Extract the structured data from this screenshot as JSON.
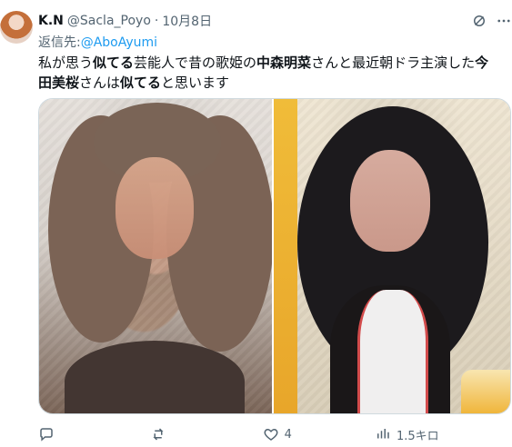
{
  "tweet": {
    "name": "K.N",
    "handle": "@Sacla_Poyo",
    "separator": "·",
    "date": "10月8日",
    "reply_to_prefix": "返信先:",
    "reply_to_handle": "@AboAyumi",
    "text": {
      "segment_1": "私が思う",
      "segment_2": "似てる",
      "segment_3": "芸能人で昔の歌姫の",
      "segment_4": "中森明菜",
      "segment_5": "さんと最近朝ドラ主演した",
      "segment_6": "今田美桜",
      "segment_7": "さんは",
      "segment_8": "似てる",
      "segment_9": "と思います"
    },
    "actions": {
      "likes": "4",
      "views": "1.5キロ"
    }
  },
  "icons": {
    "grok": "grok-icon",
    "more": "more-icon",
    "reply": "reply-icon",
    "retweet": "retweet-icon",
    "like": "heart-icon",
    "views": "views-icon",
    "bookmark": "bookmark-icon",
    "share": "share-icon"
  },
  "colors": {
    "text": "#0f1419",
    "secondary": "#536471",
    "link": "#1d9bf0",
    "border": "#cfd9de"
  }
}
